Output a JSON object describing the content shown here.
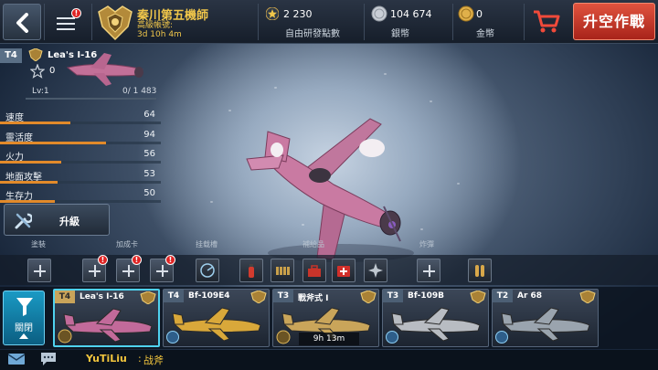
{
  "topbar": {
    "menu_badge": "!",
    "player_name": "秦川第五機師",
    "player_sub_label": "高級帳號:",
    "player_sub_time": "3d 10h 4m",
    "research_points_value": "2 230",
    "research_points_label": "自由研發點數",
    "silver_value": "104 674",
    "silver_label": "銀幣",
    "gold_value": "0",
    "gold_label": "金幣",
    "takeoff_label": "升空作戰"
  },
  "plane": {
    "tier": "T4",
    "name": "Lea's I-16",
    "level_star": "0",
    "lv_label": "Lv:1",
    "xp": "0/ 1 483",
    "xp_fraction": 0.0
  },
  "stats": [
    {
      "name": "速度",
      "value": "64",
      "fraction": 0.44
    },
    {
      "name": "靈活度",
      "value": "94",
      "fraction": 0.66
    },
    {
      "name": "火力",
      "value": "56",
      "fraction": 0.38
    },
    {
      "name": "地面攻擊",
      "value": "53",
      "fraction": 0.36
    },
    {
      "name": "生存力",
      "value": "50",
      "fraction": 0.34
    }
  ],
  "upgrade_label": "升級",
  "slot_categories": [
    "塗裝",
    "加成卡",
    "挂载槽",
    "補給品",
    "炸彈"
  ],
  "slots": [
    {
      "kind": "plus",
      "badge": ""
    },
    {
      "kind": "plus",
      "badge": "!"
    },
    {
      "kind": "plus",
      "badge": "!"
    },
    {
      "kind": "plus",
      "badge": "!"
    },
    {
      "kind": "icon",
      "icon": "radar-icon"
    },
    {
      "kind": "icon",
      "icon": "fire-extinguisher-icon"
    },
    {
      "kind": "icon",
      "icon": "ammo-belt-icon"
    },
    {
      "kind": "icon",
      "icon": "toolbox-icon"
    },
    {
      "kind": "icon",
      "icon": "medkit-icon"
    },
    {
      "kind": "icon",
      "icon": "shrapnel-icon"
    },
    {
      "kind": "plus",
      "badge": ""
    },
    {
      "kind": "icon",
      "icon": "bullets-icon"
    }
  ],
  "hangar": {
    "close_label": "關閉",
    "cards": [
      {
        "tier": "T4",
        "name": "Lea's I-16",
        "selected": true,
        "timer": "",
        "color": "#c26a9a"
      },
      {
        "tier": "T4",
        "name": "Bf-109E4",
        "selected": false,
        "timer": "",
        "color": "#d9a83a"
      },
      {
        "tier": "T3",
        "name": "戰斧式 I",
        "selected": false,
        "timer": "9h 13m",
        "color": "#c9a55a"
      },
      {
        "tier": "T3",
        "name": "Bf-109B",
        "selected": false,
        "timer": "",
        "color": "#b8bcc2"
      },
      {
        "tier": "T2",
        "name": "Ar 68",
        "selected": false,
        "timer": "",
        "color": "#9aa4ae"
      }
    ]
  },
  "chat": {
    "user": "YuTiLiu",
    "separator": ":",
    "message": "战斧"
  },
  "colors": {
    "accent_gold": "#f0c64a",
    "takeoff_red": "#c23a2a",
    "stat_bar": "#e28a2a",
    "selected_card": "#4fd2ef"
  }
}
